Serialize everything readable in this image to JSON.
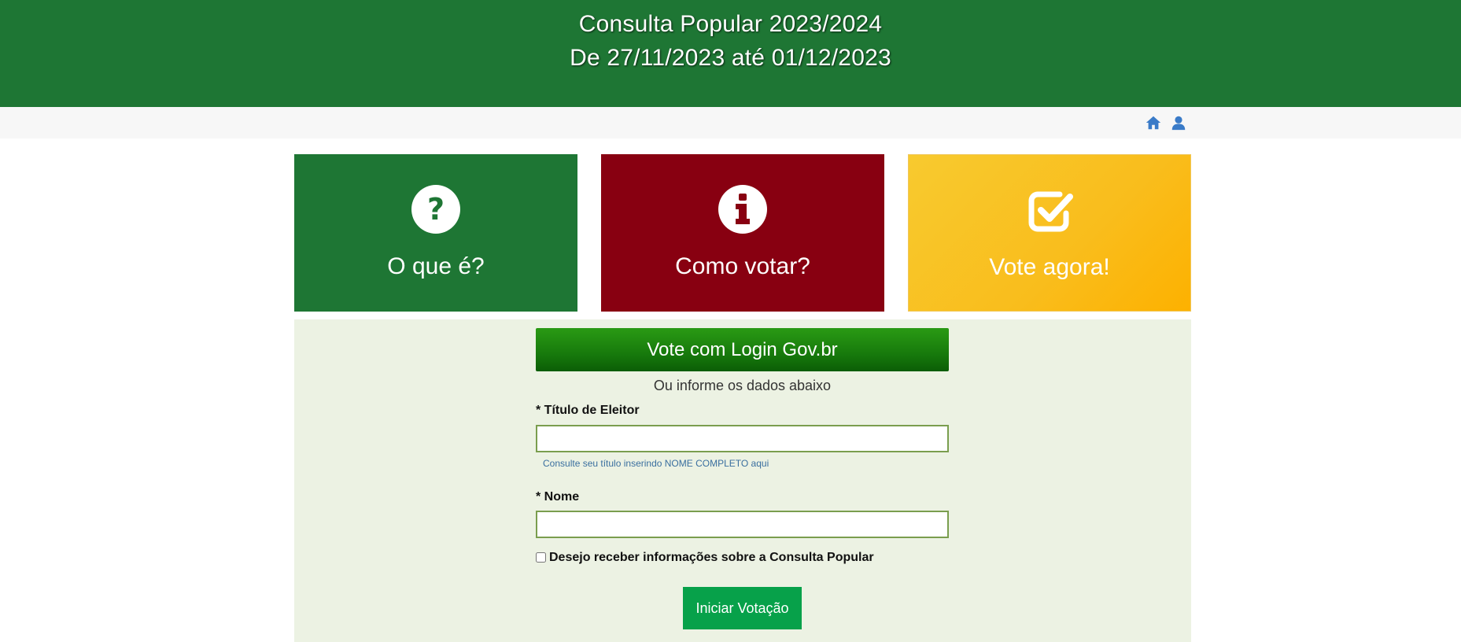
{
  "header": {
    "title": "Consulta Popular 2023/2024",
    "period": "De 27/11/2023 até 01/12/2023"
  },
  "navbar": {
    "icons": [
      "home-icon",
      "user-icon"
    ]
  },
  "tiles": [
    {
      "label": "O que é?",
      "icon": "question-circle-icon",
      "color": "#1e7634"
    },
    {
      "label": "Como votar?",
      "icon": "info-circle-icon",
      "color": "#880011"
    },
    {
      "label": "Vote agora!",
      "icon": "check-square-icon",
      "color": "#f9bd1c"
    }
  ],
  "form": {
    "govbr_button": "Vote com Login Gov.br",
    "or_text": "Ou informe os dados abaixo",
    "titulo_label": "* Título de Eleitor",
    "titulo_value": "",
    "help_link": "Consulte seu título inserindo NOME COMPLETO aqui",
    "nome_label": "* Nome",
    "nome_value": "",
    "newsletter_label": "Desejo receber informações sobre a Consulta Popular",
    "newsletter_checked": false,
    "submit_button": "Iniciar Votação"
  },
  "colors": {
    "header_bg": "#1e7634",
    "panel_bg": "#ecf2e3",
    "nav_icon": "#3a7bc8",
    "submit_bg": "#07a14a"
  }
}
